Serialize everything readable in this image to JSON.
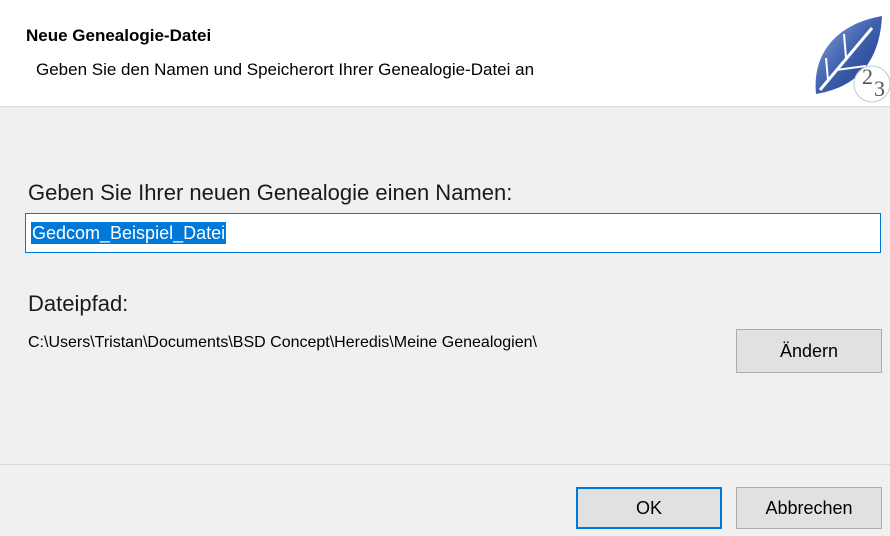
{
  "header": {
    "title": "Neue Genealogie-Datei",
    "subtitle": "Geben Sie den Namen und Speicherort Ihrer Genealogie-Datei an",
    "logo_icon": "heredis-leaf-logo-icon"
  },
  "form": {
    "name_label": "Geben Sie Ihrer neuen Genealogie einen Namen:",
    "name_value": "Gedcom_Beispiel_Datei",
    "path_label": "Dateipfad:",
    "path_value": "C:\\Users\\Tristan\\Documents\\BSD Concept\\Heredis\\Meine Genealogien\\",
    "change_button": "Ändern"
  },
  "footer": {
    "ok_button": "OK",
    "cancel_button": "Abbrechen"
  },
  "colors": {
    "accent": "#0078d7",
    "background": "#f0f0f0",
    "header_background": "#ffffff"
  }
}
